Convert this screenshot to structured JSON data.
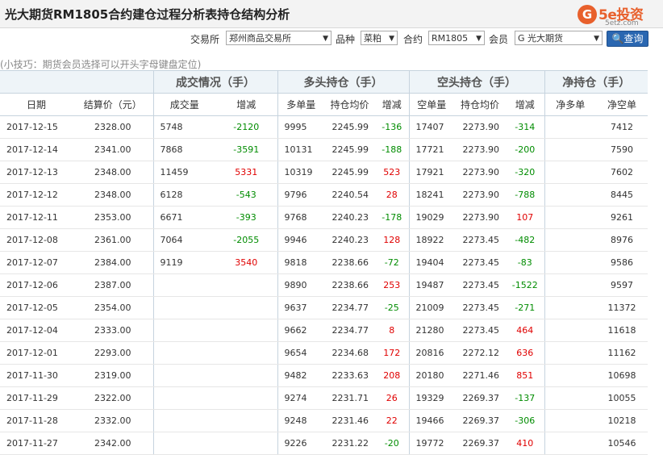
{
  "header": {
    "title": "光大期货RM1805合约建仓过程分析表持仓结构分析",
    "logo_circle": "G",
    "logo_main": "5e投资",
    "logo_sub": "5etz.com"
  },
  "filters": {
    "exchange_label": "交易所",
    "exchange_value": "郑州商品交易所",
    "product_label": "品种",
    "product_value": "菜粕",
    "contract_label": "合约",
    "contract_value": "RM1805",
    "member_label": "会员",
    "member_value": "G 光大期货",
    "query_button": "查询"
  },
  "tip": "(小技巧：期货会员选择可以开头字母键盘定位)",
  "table": {
    "groups": [
      "成交情况（手）",
      "多头持仓（手）",
      "空头持仓（手）",
      "净持仓（手）"
    ],
    "columns": [
      "日期",
      "结算价（元）",
      "成交量",
      "增减",
      "多单量",
      "持仓均价",
      "增减",
      "空单量",
      "持仓均价",
      "增减",
      "净多单",
      "净空单"
    ],
    "rows": [
      [
        "2017-12-15",
        "2328.00",
        "5748",
        "-2120",
        "9995",
        "2245.99",
        "-136",
        "17407",
        "2273.90",
        "-314",
        "",
        "7412"
      ],
      [
        "2017-12-14",
        "2341.00",
        "7868",
        "-3591",
        "10131",
        "2245.99",
        "-188",
        "17721",
        "2273.90",
        "-200",
        "",
        "7590"
      ],
      [
        "2017-12-13",
        "2348.00",
        "11459",
        "5331",
        "10319",
        "2245.99",
        "523",
        "17921",
        "2273.90",
        "-320",
        "",
        "7602"
      ],
      [
        "2017-12-12",
        "2348.00",
        "6128",
        "-543",
        "9796",
        "2240.54",
        "28",
        "18241",
        "2273.90",
        "-788",
        "",
        "8445"
      ],
      [
        "2017-12-11",
        "2353.00",
        "6671",
        "-393",
        "9768",
        "2240.23",
        "-178",
        "19029",
        "2273.90",
        "107",
        "",
        "9261"
      ],
      [
        "2017-12-08",
        "2361.00",
        "7064",
        "-2055",
        "9946",
        "2240.23",
        "128",
        "18922",
        "2273.45",
        "-482",
        "",
        "8976"
      ],
      [
        "2017-12-07",
        "2384.00",
        "9119",
        "3540",
        "9818",
        "2238.66",
        "-72",
        "19404",
        "2273.45",
        "-83",
        "",
        "9586"
      ],
      [
        "2017-12-06",
        "2387.00",
        "",
        "",
        "9890",
        "2238.66",
        "253",
        "19487",
        "2273.45",
        "-1522",
        "",
        "9597"
      ],
      [
        "2017-12-05",
        "2354.00",
        "",
        "",
        "9637",
        "2234.77",
        "-25",
        "21009",
        "2273.45",
        "-271",
        "",
        "11372"
      ],
      [
        "2017-12-04",
        "2333.00",
        "",
        "",
        "9662",
        "2234.77",
        "8",
        "21280",
        "2273.45",
        "464",
        "",
        "11618"
      ],
      [
        "2017-12-01",
        "2293.00",
        "",
        "",
        "9654",
        "2234.68",
        "172",
        "20816",
        "2272.12",
        "636",
        "",
        "11162"
      ],
      [
        "2017-11-30",
        "2319.00",
        "",
        "",
        "9482",
        "2233.63",
        "208",
        "20180",
        "2271.46",
        "851",
        "",
        "10698"
      ],
      [
        "2017-11-29",
        "2322.00",
        "",
        "",
        "9274",
        "2231.71",
        "26",
        "19329",
        "2269.37",
        "-137",
        "",
        "10055"
      ],
      [
        "2017-11-28",
        "2332.00",
        "",
        "",
        "9248",
        "2231.46",
        "22",
        "19466",
        "2269.37",
        "-306",
        "",
        "10218"
      ],
      [
        "2017-11-27",
        "2342.00",
        "",
        "",
        "9226",
        "2231.22",
        "-20",
        "19772",
        "2269.37",
        "410",
        "",
        "10546"
      ]
    ]
  },
  "colors": {
    "positive": "#e00000",
    "negative": "#008c00",
    "header_bg": "#eef4f8",
    "button": "#2a67b1"
  }
}
